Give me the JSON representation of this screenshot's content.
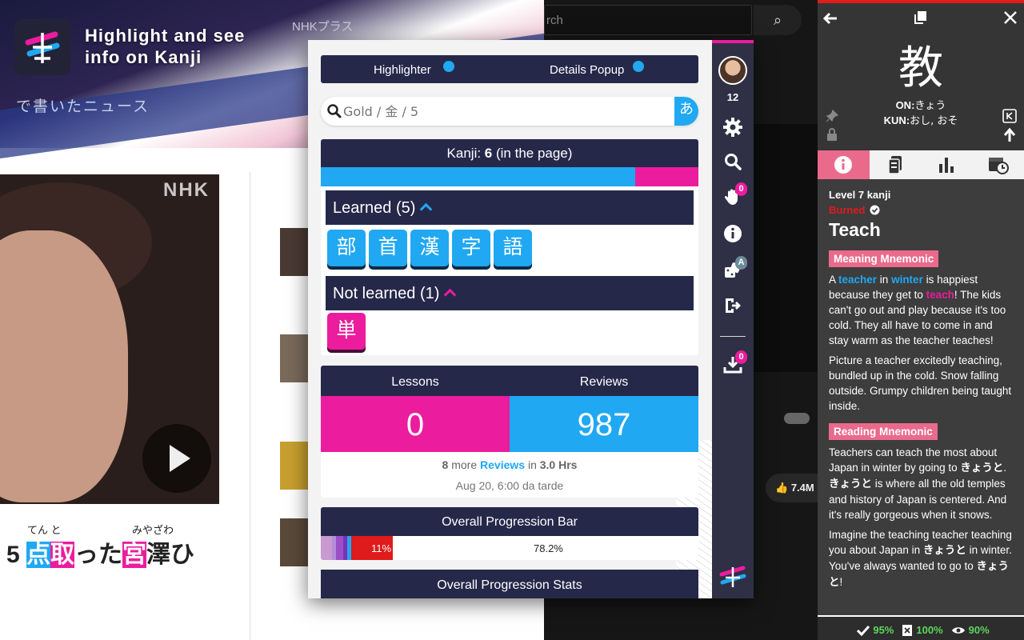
{
  "feature": {
    "title": "Highlight and see\ninfo on Kanji"
  },
  "background": {
    "nhkplus_label": "NHKプラス",
    "news_label": "で書いたニュース",
    "nhk_logo": "NHK",
    "search_placeholder": "rch",
    "like_count": "7.4M",
    "headline_prefix": "5",
    "headline_k1": "点",
    "headline_k2": "取",
    "headline_mid": "った",
    "headline_k3": "宮",
    "headline_suffix": "澤ひ",
    "furigana_1": "てん と",
    "furigana_2": "みやざわ"
  },
  "popup": {
    "toggles": [
      {
        "label": "Highlighter",
        "enabled": true
      },
      {
        "label": "Details Popup",
        "enabled": true
      }
    ],
    "search": {
      "placeholder": "Gold / 金 / 5",
      "kana_button": "あ"
    },
    "kanji_header_prefix": "Kanji: ",
    "kanji_count": "6",
    "kanji_header_suffix": " (in the page)",
    "learned_fraction": 0.833,
    "learned": {
      "label": "Learned (5)",
      "kanji": [
        "部",
        "首",
        "漢",
        "字",
        "語"
      ]
    },
    "not_learned": {
      "label": "Not learned (1)",
      "kanji": [
        "単"
      ]
    },
    "lessons_label": "Lessons",
    "reviews_label": "Reviews",
    "lessons_count": "0",
    "reviews_count": "987",
    "more_count": "8",
    "more_text": " more ",
    "more_link": "Reviews",
    "more_in": " in ",
    "more_time": "3.0 Hrs",
    "next_date": "Aug 20, 6:00 da tarde",
    "progression_bar_title": "Overall Progression Bar",
    "progression_bar": {
      "segments": [
        {
          "color": "#c89ad0",
          "value": 0.03
        },
        {
          "color": "#b58ed8",
          "value": 0.01
        },
        {
          "color": "#9b4fc9",
          "value": 0.02
        },
        {
          "color": "#7b32b8",
          "value": 0.01
        },
        {
          "color": "#20a8f2",
          "value": 0.01
        },
        {
          "color": "#e01b1b",
          "value": 0.11
        }
      ],
      "burned_label": "11%",
      "overall_label": "78.2%"
    },
    "progression_stats_title": "Overall Progression Stats"
  },
  "sidebar": {
    "level": "12",
    "blacklist_badge": "0",
    "assign_badge": "A",
    "download_badge": "0"
  },
  "details": {
    "kanji": "教",
    "on_label": "ON:",
    "on_value": "きょう",
    "kun_label": "KUN:",
    "kun_value": "おし, おそ",
    "level": "Level 7 kanji",
    "srs_stage": "Burned",
    "meaning": "Teach",
    "meaning_mnemonic_label": "Meaning Mnemonic",
    "meaning_mnemonic": {
      "p1_a": "A ",
      "p1_teacher": "teacher",
      "p1_b": " in ",
      "p1_winter": "winter",
      "p1_c": " is happiest because they get to ",
      "p1_teach": "teach",
      "p1_d": "! The kids can't go out and play because it's too cold. They all have to come in and stay warm as the teacher teaches!",
      "p2": "Picture a teacher excitedly teaching, bundled up in the cold. Snow falling outside. Grumpy children being taught inside."
    },
    "reading_mnemonic_label": "Reading Mnemonic",
    "reading_mnemonic": {
      "p1_a": "Teachers can teach the most about Japan in winter by going to ",
      "p1_kyouto1": "きょうと",
      "p1_b": ". ",
      "p1_kyouto2": "きょうと",
      "p1_c": " is where all the old temples and history of Japan is centered. And it's really gorgeous when it snows.",
      "p2_a": "Imagine the teaching teacher teaching you about Japan in ",
      "p2_kyo": "きょうと",
      "p2_b": " in winter. You've always wanted to go to ",
      "p2_kyouto": "きょうと",
      "p2_c": "!"
    },
    "stats": {
      "meaning_pct": "95%",
      "reading_pct": "100%",
      "overall_pct": "90%"
    }
  },
  "colors": {
    "accent_pink": "#ec1c9e",
    "accent_blue": "#20a8f2",
    "navy": "#26284a",
    "burned_red": "#e01b1b"
  }
}
